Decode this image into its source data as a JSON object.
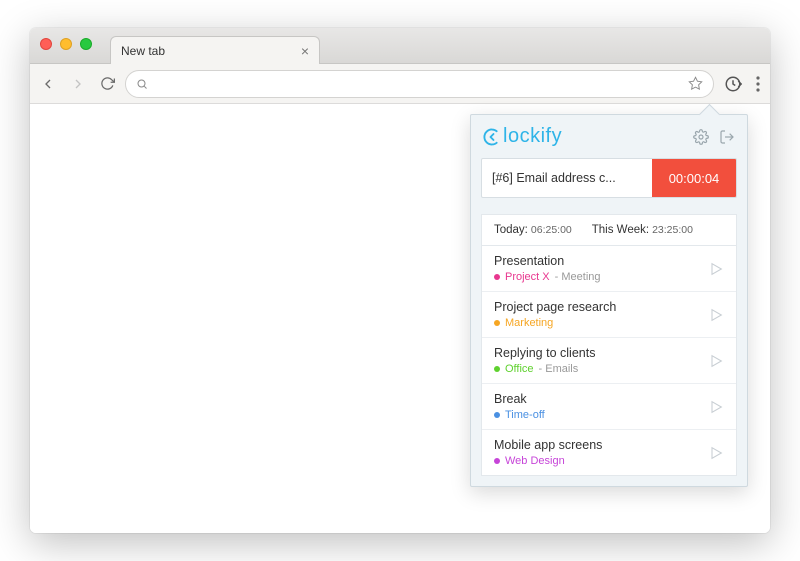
{
  "browser": {
    "tab_title": "New tab"
  },
  "panel": {
    "logo_text": "lockify",
    "timer": {
      "description": "[#6] Email address c...",
      "elapsed": "00:00:04"
    },
    "stats": {
      "today_label": "Today:",
      "today_value": "06:25:00",
      "week_label": "This Week:",
      "week_value": "23:25:00"
    },
    "entries": [
      {
        "title": "Presentation",
        "project": "Project X",
        "task": "Meeting",
        "color": "#e8378f"
      },
      {
        "title": "Project page research",
        "project": "Marketing",
        "task": "",
        "color": "#f6a623"
      },
      {
        "title": "Replying to clients",
        "project": "Office",
        "task": "Emails",
        "color": "#5fd12e"
      },
      {
        "title": "Break",
        "project": "Time-off",
        "task": "",
        "color": "#4a90e2"
      },
      {
        "title": "Mobile app screens",
        "project": "Web Design",
        "task": "",
        "color": "#c644d8"
      }
    ]
  }
}
